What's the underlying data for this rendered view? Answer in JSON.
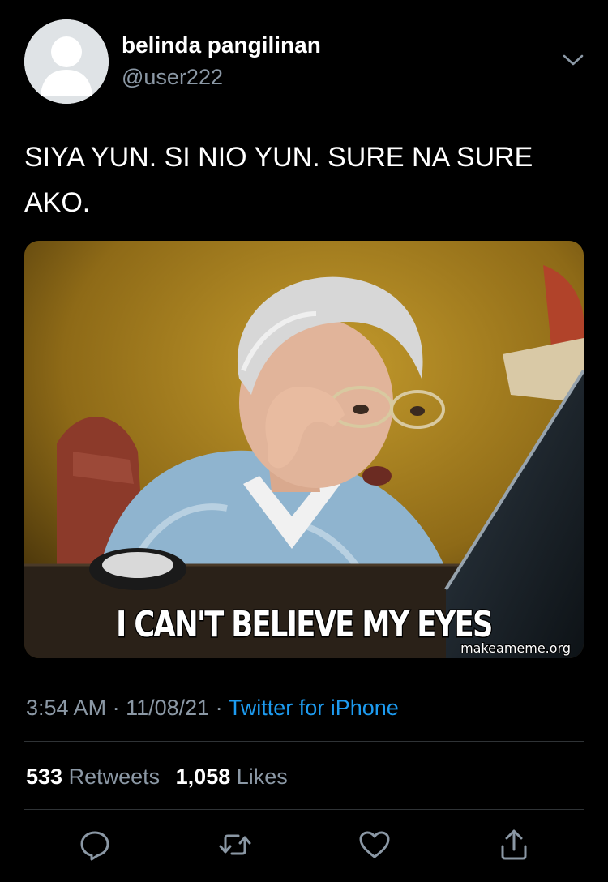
{
  "user": {
    "display_name": "belinda pangilinan",
    "handle": "@user222",
    "avatar_icon": "default-avatar-icon"
  },
  "tweet": {
    "text": "SIYA YUN. SI NIO YUN. SURE NA SURE AKO."
  },
  "media": {
    "caption": "I CAN'T BELIEVE MY EYES",
    "watermark": "makeameme.org"
  },
  "meta": {
    "time": "3:54 AM",
    "separator": " · ",
    "date": "11/08/21",
    "source": "Twitter for iPhone"
  },
  "stats": {
    "retweets_count": "533",
    "retweets_label": "Retweets",
    "likes_count": "1,058",
    "likes_label": "Likes"
  },
  "actions": {
    "reply_icon": "reply-icon",
    "retweet_icon": "retweet-icon",
    "like_icon": "heart-icon",
    "share_icon": "share-icon"
  },
  "colors": {
    "background": "#000000",
    "secondary_text": "#8b98a5",
    "link": "#1d9bf0",
    "divider": "#2f3336"
  }
}
